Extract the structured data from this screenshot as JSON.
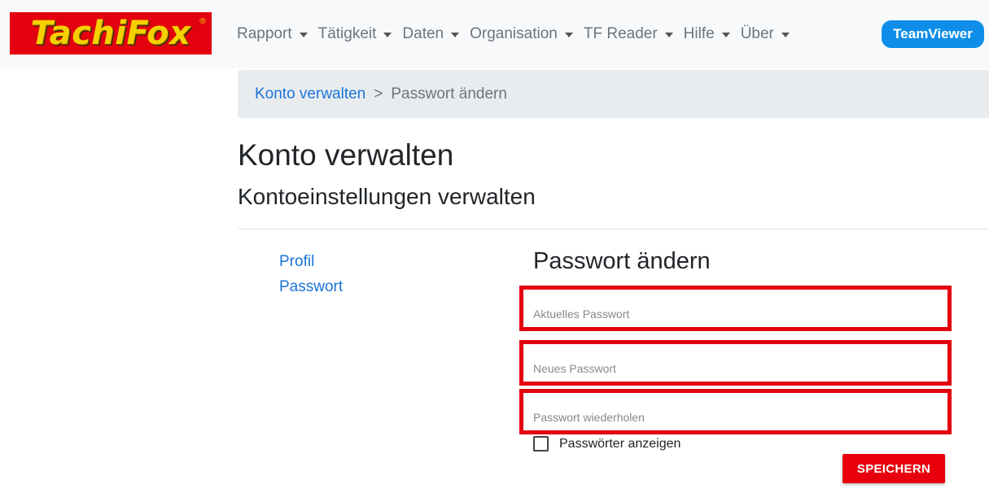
{
  "brand": {
    "logo_text": "TachiFox",
    "logo_mark": "®"
  },
  "nav": {
    "items": [
      {
        "label": "Rapport"
      },
      {
        "label": "Tätigkeit"
      },
      {
        "label": "Daten"
      },
      {
        "label": "Organisation"
      },
      {
        "label": "TF Reader"
      },
      {
        "label": "Hilfe"
      },
      {
        "label": "Über"
      }
    ],
    "teamviewer_label": "TeamViewer"
  },
  "breadcrumb": {
    "parent": "Konto verwalten",
    "separator": ">",
    "current": "Passwort ändern"
  },
  "page": {
    "title": "Konto verwalten",
    "subtitle": "Kontoeinstellungen verwalten"
  },
  "side_menu": {
    "items": [
      {
        "label": "Profil"
      },
      {
        "label": "Passwort"
      }
    ]
  },
  "form": {
    "title": "Passwort ändern",
    "current_password": {
      "placeholder": "Aktuelles Passwort",
      "value": ""
    },
    "new_password": {
      "placeholder": "Neues Passwort",
      "value": ""
    },
    "confirm_password": {
      "placeholder": "Passwort wiederholen",
      "value": ""
    },
    "show_passwords_label": "Passwörter anzeigen",
    "show_passwords_checked": false,
    "save_label": "SPEICHERN"
  },
  "colors": {
    "brand_red": "#e3000f",
    "brand_yellow": "#f5d000",
    "link_blue": "#1a73d8",
    "teamviewer_blue": "#0e8ee9",
    "highlight_red": "#e3000f"
  }
}
